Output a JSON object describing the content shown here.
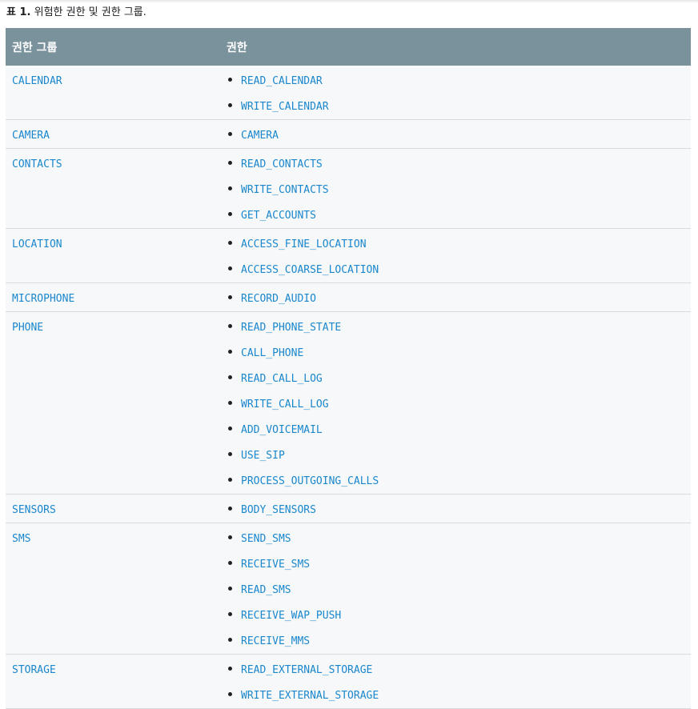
{
  "caption": {
    "label": "표 1.",
    "text": " 위험한 권한 및 권한 그룹."
  },
  "table": {
    "headers": [
      "권한 그룹",
      "권한"
    ],
    "rows": [
      {
        "group": "CALENDAR",
        "permissions": [
          "READ_CALENDAR",
          "WRITE_CALENDAR"
        ]
      },
      {
        "group": "CAMERA",
        "permissions": [
          "CAMERA"
        ]
      },
      {
        "group": "CONTACTS",
        "permissions": [
          "READ_CONTACTS",
          "WRITE_CONTACTS",
          "GET_ACCOUNTS"
        ]
      },
      {
        "group": "LOCATION",
        "permissions": [
          "ACCESS_FINE_LOCATION",
          "ACCESS_COARSE_LOCATION"
        ]
      },
      {
        "group": "MICROPHONE",
        "permissions": [
          "RECORD_AUDIO"
        ]
      },
      {
        "group": "PHONE",
        "permissions": [
          "READ_PHONE_STATE",
          "CALL_PHONE",
          "READ_CALL_LOG",
          "WRITE_CALL_LOG",
          "ADD_VOICEMAIL",
          "USE_SIP",
          "PROCESS_OUTGOING_CALLS"
        ]
      },
      {
        "group": "SENSORS",
        "permissions": [
          "BODY_SENSORS"
        ]
      },
      {
        "group": "SMS",
        "permissions": [
          "SEND_SMS",
          "RECEIVE_SMS",
          "READ_SMS",
          "RECEIVE_WAP_PUSH",
          "RECEIVE_MMS"
        ]
      },
      {
        "group": "STORAGE",
        "permissions": [
          "READ_EXTERNAL_STORAGE",
          "WRITE_EXTERNAL_STORAGE"
        ]
      }
    ]
  },
  "colors": {
    "header_bg": "#7a929c",
    "link": "#1a87cc",
    "row_bg": "#f7f8fa"
  }
}
